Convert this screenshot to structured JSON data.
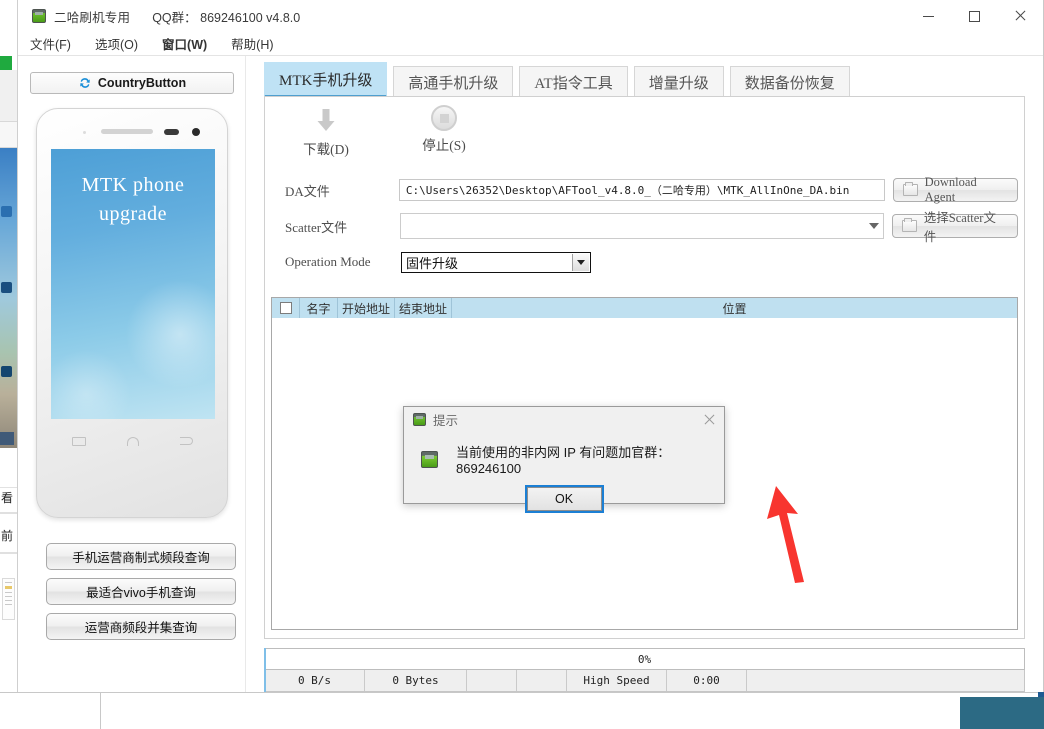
{
  "window": {
    "app_icon": "android-phone-icon",
    "title": "二哈刷机专用",
    "qq_info": "QQ群： 869246100  v4.8.0",
    "controls": {
      "minimize": "minimize-icon",
      "maximize": "maximize-icon",
      "close": "close-icon"
    }
  },
  "menubar": {
    "items": [
      {
        "label": "文件(F)",
        "bold": false
      },
      {
        "label": "选项(O)",
        "bold": false
      },
      {
        "label": "窗口(W)",
        "bold": true
      },
      {
        "label": "帮助(H)",
        "bold": false
      }
    ]
  },
  "sidebar": {
    "country_button": {
      "label": "CountryButton",
      "icon": "refresh-sync-icon"
    },
    "phone_preview": {
      "line1": "MTK  phone",
      "line2": "upgrade"
    },
    "buttons": [
      {
        "label": "手机运营商制式频段查询"
      },
      {
        "label": "最适合vivo手机查询"
      },
      {
        "label": "运营商频段并集查询"
      }
    ]
  },
  "tabs": [
    {
      "label": "MTK手机升级",
      "active": true
    },
    {
      "label": "高通手机升级",
      "active": false
    },
    {
      "label": "AT指令工具",
      "active": false
    },
    {
      "label": "增量升级",
      "active": false
    },
    {
      "label": "数据备份恢复",
      "active": false
    }
  ],
  "toolbar": {
    "download": {
      "label": "下载(D)",
      "icon": "download-arrow-icon"
    },
    "stop": {
      "label": "停止(S)",
      "icon": "stop-circle-icon"
    }
  },
  "form": {
    "da_file": {
      "label": "DA文件",
      "value": "C:\\Users\\26352\\Desktop\\AFTool_v4.8.0_（二哈专用）\\MTK_AllInOne_DA.bin",
      "button": "Download Agent"
    },
    "scatter_file": {
      "label": "Scatter文件",
      "value": "",
      "placeholder": "",
      "button": "选择Scatter文件"
    },
    "operation_mode": {
      "label": "Operation Mode",
      "value": "固件升级"
    }
  },
  "table": {
    "headers": [
      "",
      "名字",
      "开始地址",
      "结束地址",
      "位置"
    ],
    "rows": []
  },
  "dialog": {
    "icon": "android-phone-icon",
    "title": "提示",
    "close": "close-icon",
    "message": "当前使用的非内网 IP 有问题加官群：869246100",
    "ok_label": "OK"
  },
  "status": {
    "progress_text": "0%",
    "progress_percent": 0,
    "cells": [
      "0 B/s",
      "0 Bytes",
      "",
      "",
      "High Speed",
      "0:00",
      ""
    ]
  },
  "colors": {
    "tab_active_bg": "#bfe2f5",
    "tab_active_underline": "#4f9fcf",
    "grid_header_bg": "#bfe0f0",
    "dialog_focus": "#1b7fd4",
    "annotation_arrow": "#f8352f",
    "phone_screen": "#63aede"
  }
}
